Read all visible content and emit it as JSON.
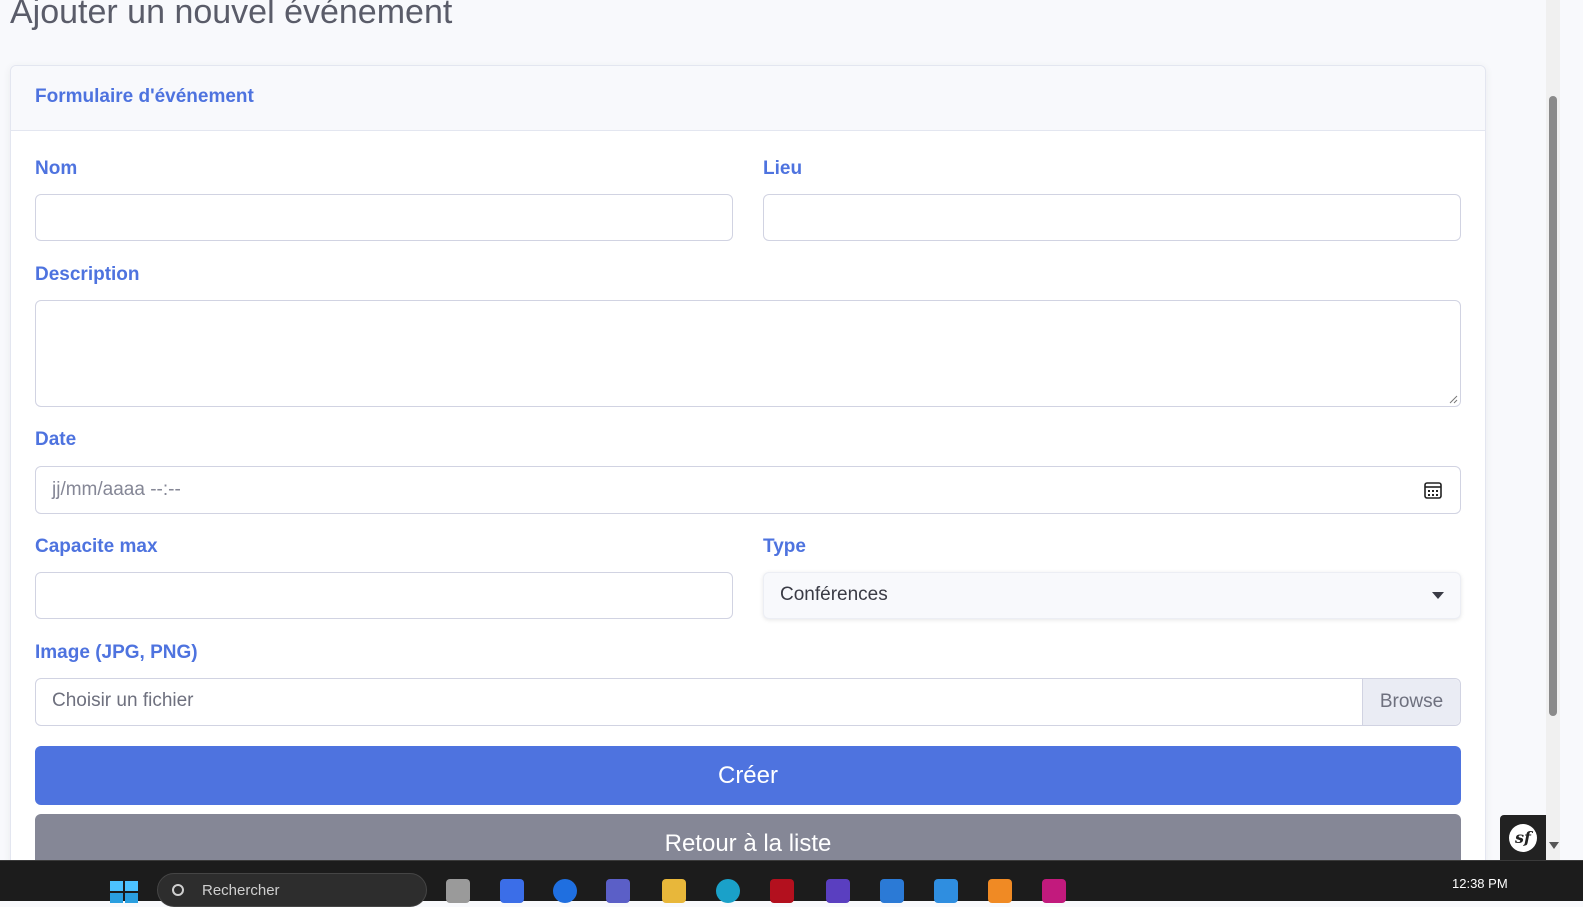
{
  "page": {
    "heading": "Ajouter un nouvel événement"
  },
  "card": {
    "title": "Formulaire d'événement"
  },
  "form": {
    "nom": {
      "label": "Nom",
      "value": ""
    },
    "lieu": {
      "label": "Lieu",
      "value": ""
    },
    "description": {
      "label": "Description",
      "value": ""
    },
    "date": {
      "label": "Date",
      "placeholder": "jj/mm/aaaa  --:--"
    },
    "capacite": {
      "label": "Capacite max",
      "value": ""
    },
    "type": {
      "label": "Type",
      "selected": "Conférences"
    },
    "image": {
      "label": "Image (JPG, PNG)",
      "placeholder": "Choisir un fichier",
      "browse_label": "Browse"
    }
  },
  "buttons": {
    "create": "Créer",
    "back": "Retour à la liste"
  },
  "taskbar": {
    "search_text": "Rechercher",
    "time": "12:38 PM"
  },
  "colors": {
    "accent": "#4e73df",
    "secondary": "#858796",
    "page_bg": "#f8f9fc"
  },
  "icons": [
    "calendar-icon",
    "caret-down-icon",
    "symfony-logo-icon",
    "windows-start-icon",
    "search-icon"
  ]
}
